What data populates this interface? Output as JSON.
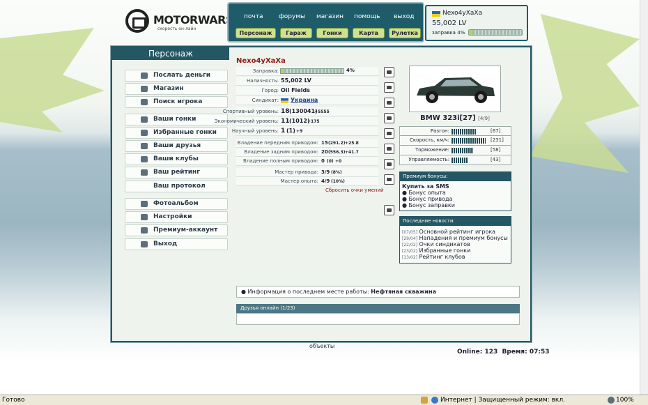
{
  "logo": {
    "title": "MOTORWARS.RU",
    "subtitle": "скорость он-лайн"
  },
  "topnav": {
    "links": [
      "почта",
      "форумы",
      "магазин",
      "помощь",
      "выход"
    ],
    "buttons": [
      "Персонаж",
      "Гараж",
      "Гонки",
      "Карта",
      "Рулетка"
    ]
  },
  "user": {
    "name": "Nexo4yXaXa",
    "money": "55,002 LV",
    "fuel_label": "заправка 4%",
    "fuel_pct": 4
  },
  "section_title": "Персонаж",
  "menu": [
    {
      "label": "Послать деньги",
      "icon": "send-money-icon"
    },
    {
      "label": "Магазин",
      "icon": "shop-icon"
    },
    {
      "label": "Поиск игрока",
      "icon": "search-icon"
    },
    {
      "label": "Ваши гонки",
      "icon": "steering-wheel-icon"
    },
    {
      "label": "Избранные гонки",
      "icon": "steering-wheel-icon"
    },
    {
      "label": "Ваши друзья",
      "icon": "friends-icon"
    },
    {
      "label": "Ваши клубы",
      "icon": "clubs-icon"
    },
    {
      "label": "Ваш рейтинг",
      "icon": "rating-icon"
    },
    {
      "label": "Ваш протокол",
      "icon": ""
    },
    {
      "label": "Фотоальбом",
      "icon": "camera-icon"
    },
    {
      "label": "Настройки",
      "icon": "settings-icon"
    },
    {
      "label": "Премиум-аккаунт",
      "icon": "premium-icon"
    },
    {
      "label": "Выход",
      "icon": "exit-icon"
    }
  ],
  "profile": {
    "name": "Nexo4yXaXa",
    "fuel": {
      "label": "Заправка:",
      "value": "4%",
      "pct": 4
    },
    "cash": {
      "label": "Наличность:",
      "value": "55,002 LV"
    },
    "city": {
      "label": "Город:",
      "value": "Oil Fields"
    },
    "syndicate": {
      "label": "Синдикат:",
      "value": "Украина"
    },
    "sport": {
      "label": "Спортивный уровень:",
      "level": "18",
      "exp": "(130041)",
      "delta": "+5555"
    },
    "econ": {
      "label": "Экономический уровень:",
      "level": "11",
      "exp": "(1012)",
      "delta": "+175"
    },
    "sci": {
      "label": "Научный уровень:",
      "level": "1",
      "exp": "(1)",
      "delta": "+9"
    },
    "fwd": {
      "label": "Владение передним приводом:",
      "level": "15",
      "exp": "(291.2)",
      "delta": "+25.8"
    },
    "rwd": {
      "label": "Владение задним приводом:",
      "level": "20",
      "exp": "(556.3)",
      "delta": "+41.7"
    },
    "awd": {
      "label": "Владение полным приводом:",
      "level": "0",
      "exp": "(0)",
      "delta": "+0"
    },
    "drive_master": {
      "label": "Мастер привода:",
      "value": "3/9",
      "pct": "(8%)"
    },
    "exp_master": {
      "label": "Мастер опыта:",
      "value": "4/9",
      "pct": "(10%)"
    },
    "reset": "Сбросить очки умений"
  },
  "tools": [
    "suspension-icon",
    "engine-icon",
    "exhaust-icon",
    "turbo-icon",
    "brake-icon",
    "wheel-icon",
    "transmission-icon",
    "nitro-icon",
    "body-icon"
  ],
  "car": {
    "name": "BMW 323i",
    "tier": "[27]",
    "slots": "[4/9]"
  },
  "car_stats": [
    {
      "label": "Разгон:",
      "value": "[67]",
      "level": 67
    },
    {
      "label": "Скорость, км/ч:",
      "value": "[231]",
      "level": 90
    },
    {
      "label": "Торможение:",
      "value": "[58]",
      "level": 58
    },
    {
      "label": "Управляемость:",
      "value": "[43]",
      "level": 43
    }
  ],
  "premium": {
    "header": "Премиум бонусы:",
    "title": "Купить за SMS",
    "items": [
      "Бонус опыта",
      "Бонус привода",
      "Бонус заправки"
    ]
  },
  "news": {
    "header": "Последние новости:",
    "items": [
      {
        "date": "[07/05]",
        "text": "Основной рейтинг игрока"
      },
      {
        "date": "[29/04]",
        "text": "Нападения и премиум бонусы"
      },
      {
        "date": "[22/02]",
        "text": "Очки синдикатов"
      },
      {
        "date": "[23/02]",
        "text": "Избранные гонки"
      },
      {
        "date": "[13/02]",
        "text": "Рейтинг клубов"
      }
    ]
  },
  "work_info": {
    "label": "Информация о последнем месте работы:",
    "value": "Нефтяная скважина"
  },
  "friends": {
    "header": "Друзья онлайн (1/23)"
  },
  "footer": {
    "objects": "объекты",
    "online": "Online: 123",
    "time": "Время: 07:53"
  },
  "statusbar": {
    "left": "Готово",
    "zone": "Интернет | Защищенный режим: вкл.",
    "zoom": "100%"
  }
}
